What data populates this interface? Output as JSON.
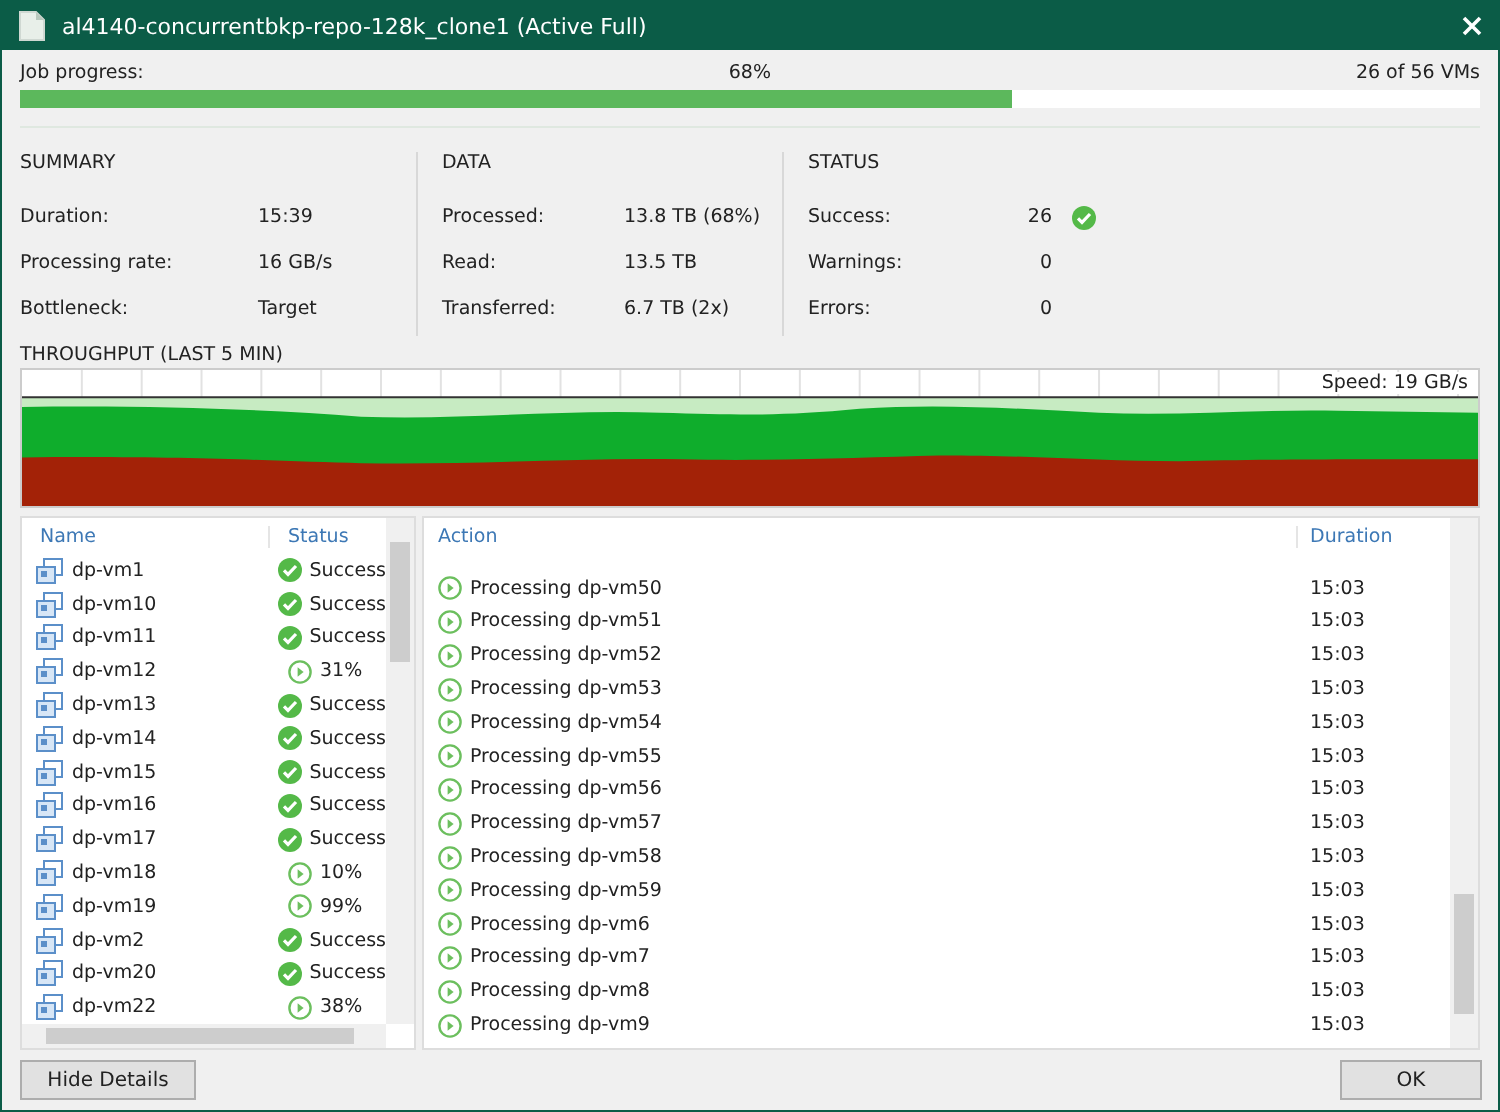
{
  "window": {
    "title": "al4140-concurrentbkp-repo-128k_clone1 (Active Full)"
  },
  "job_progress": {
    "label": "Job progress:",
    "percent": "68%",
    "count": "26 of 56 VMs",
    "level": 0.68
  },
  "summary": {
    "heading": "SUMMARY",
    "rows": [
      {
        "label": "Duration:",
        "value": "15:39"
      },
      {
        "label": "Processing rate:",
        "value": "16 GB/s"
      },
      {
        "label": "Bottleneck:",
        "value": "Target"
      }
    ]
  },
  "data": {
    "heading": "DATA",
    "rows": [
      {
        "label": "Processed:",
        "value": "13.8 TB (68%)"
      },
      {
        "label": "Read:",
        "value": "13.5 TB"
      },
      {
        "label": "Transferred:",
        "value": "6.7 TB (2x)"
      }
    ]
  },
  "status": {
    "heading": "STATUS",
    "rows": [
      {
        "label": "Success:",
        "value": "26",
        "ok_icon": true
      },
      {
        "label": "Warnings:",
        "value": "0",
        "ok_icon": false
      },
      {
        "label": "Errors:",
        "value": "0",
        "ok_icon": false
      }
    ]
  },
  "throughput": {
    "heading": "THROUGHPUT (LAST 5 MIN)",
    "speed": "Speed: 19 GB/s"
  },
  "vm_list": {
    "columns": [
      "Name",
      "Status"
    ],
    "rows": [
      {
        "name": "dp-vm1",
        "kind": "success",
        "status": "Success"
      },
      {
        "name": "dp-vm10",
        "kind": "success",
        "status": "Success"
      },
      {
        "name": "dp-vm11",
        "kind": "success",
        "status": "Success"
      },
      {
        "name": "dp-vm12",
        "kind": "running",
        "status": "31%"
      },
      {
        "name": "dp-vm13",
        "kind": "success",
        "status": "Success"
      },
      {
        "name": "dp-vm14",
        "kind": "success",
        "status": "Success"
      },
      {
        "name": "dp-vm15",
        "kind": "success",
        "status": "Success"
      },
      {
        "name": "dp-vm16",
        "kind": "success",
        "status": "Success"
      },
      {
        "name": "dp-vm17",
        "kind": "success",
        "status": "Success"
      },
      {
        "name": "dp-vm18",
        "kind": "running",
        "status": "10%"
      },
      {
        "name": "dp-vm19",
        "kind": "running",
        "status": "99%"
      },
      {
        "name": "dp-vm2",
        "kind": "success",
        "status": "Success"
      },
      {
        "name": "dp-vm20",
        "kind": "success",
        "status": "Success"
      },
      {
        "name": "dp-vm22",
        "kind": "running",
        "status": "38%"
      }
    ]
  },
  "action_list": {
    "columns": [
      "Action",
      "Duration"
    ],
    "rows": [
      {
        "action": "Processing dp-vm50",
        "duration": "15:03"
      },
      {
        "action": "Processing dp-vm51",
        "duration": "15:03"
      },
      {
        "action": "Processing dp-vm52",
        "duration": "15:03"
      },
      {
        "action": "Processing dp-vm53",
        "duration": "15:03"
      },
      {
        "action": "Processing dp-vm54",
        "duration": "15:03"
      },
      {
        "action": "Processing dp-vm55",
        "duration": "15:03"
      },
      {
        "action": "Processing dp-vm56",
        "duration": "15:03"
      },
      {
        "action": "Processing dp-vm57",
        "duration": "15:03"
      },
      {
        "action": "Processing dp-vm58",
        "duration": "15:03"
      },
      {
        "action": "Processing dp-vm59",
        "duration": "15:03"
      },
      {
        "action": "Processing dp-vm6",
        "duration": "15:03"
      },
      {
        "action": "Processing dp-vm7",
        "duration": "15:03"
      },
      {
        "action": "Processing dp-vm8",
        "duration": "15:03"
      },
      {
        "action": "Processing dp-vm9",
        "duration": "15:03"
      }
    ]
  },
  "buttons": [
    {
      "label": "Hide Details"
    },
    {
      "label": "OK"
    }
  ]
}
